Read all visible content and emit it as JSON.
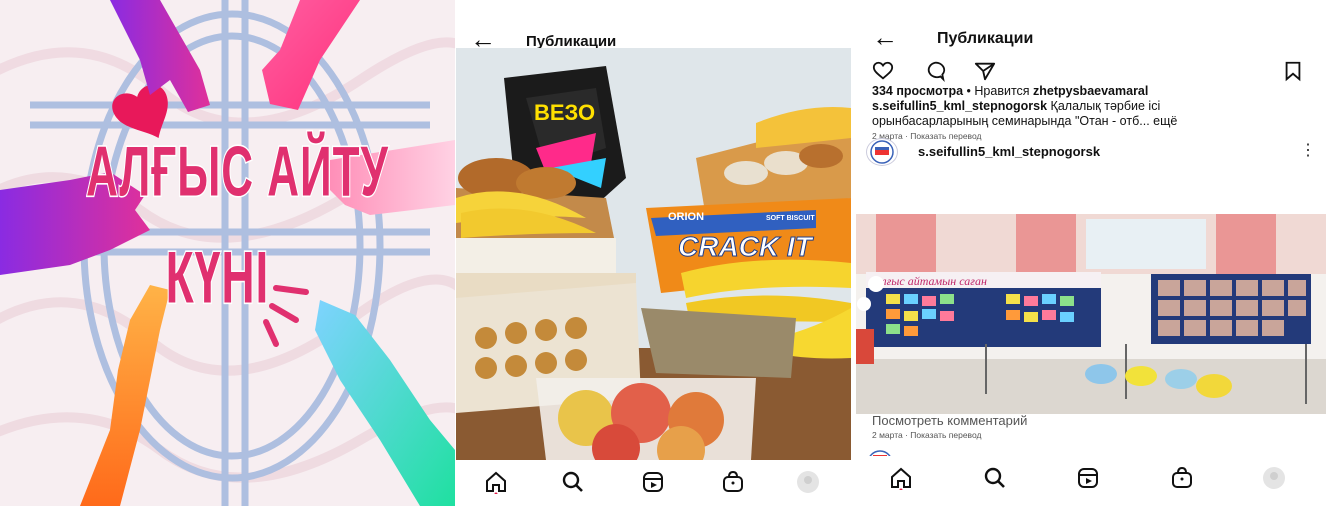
{
  "poster": {
    "line1": "АЛҒЫС АЙТУ",
    "line2": "КҮНІ",
    "colors": {
      "text": "#e0306f",
      "background": "#f7eef1",
      "emblem": "#aebfe0"
    }
  },
  "post_left": {
    "back_icon": "arrow-left-icon",
    "title": "Публикации",
    "photo_label": "CRACK IT",
    "photo_brand": "ORION",
    "photo_subbrand": "SOFT BISCUIT",
    "photo_bag_label": "ВЕЗО",
    "nav": [
      "home-icon",
      "search-icon",
      "reels-icon",
      "shop-icon",
      "profile-icon"
    ]
  },
  "post_right": {
    "back_icon": "arrow-left-icon",
    "title": "Публикации",
    "actions": [
      "heart-icon",
      "comment-icon",
      "share-icon",
      "bookmark-icon"
    ],
    "views": "334 просмотра",
    "liked_prefix": " • Нравится ",
    "liked_by": "zhetpysbaevamaral",
    "caption_user": "s.seifullin5_kml_stepnogorsk",
    "caption_line1_rest": " Қалалық тәрбие ісі",
    "caption_line2": "орынбасарларының семинарында \"Отан - отб... ещё",
    "meta1": "2 марта · Показать перевод",
    "author_name": "s.seifullin5_kml_stepnogorsk",
    "board_title": "Алғыс айтамын саған",
    "comments_link": "Посмотреть комментарий",
    "meta2": "2 марта · Показать перевод",
    "nav": [
      "home-icon",
      "search-icon",
      "reels-icon",
      "shop-icon",
      "profile-icon"
    ]
  }
}
